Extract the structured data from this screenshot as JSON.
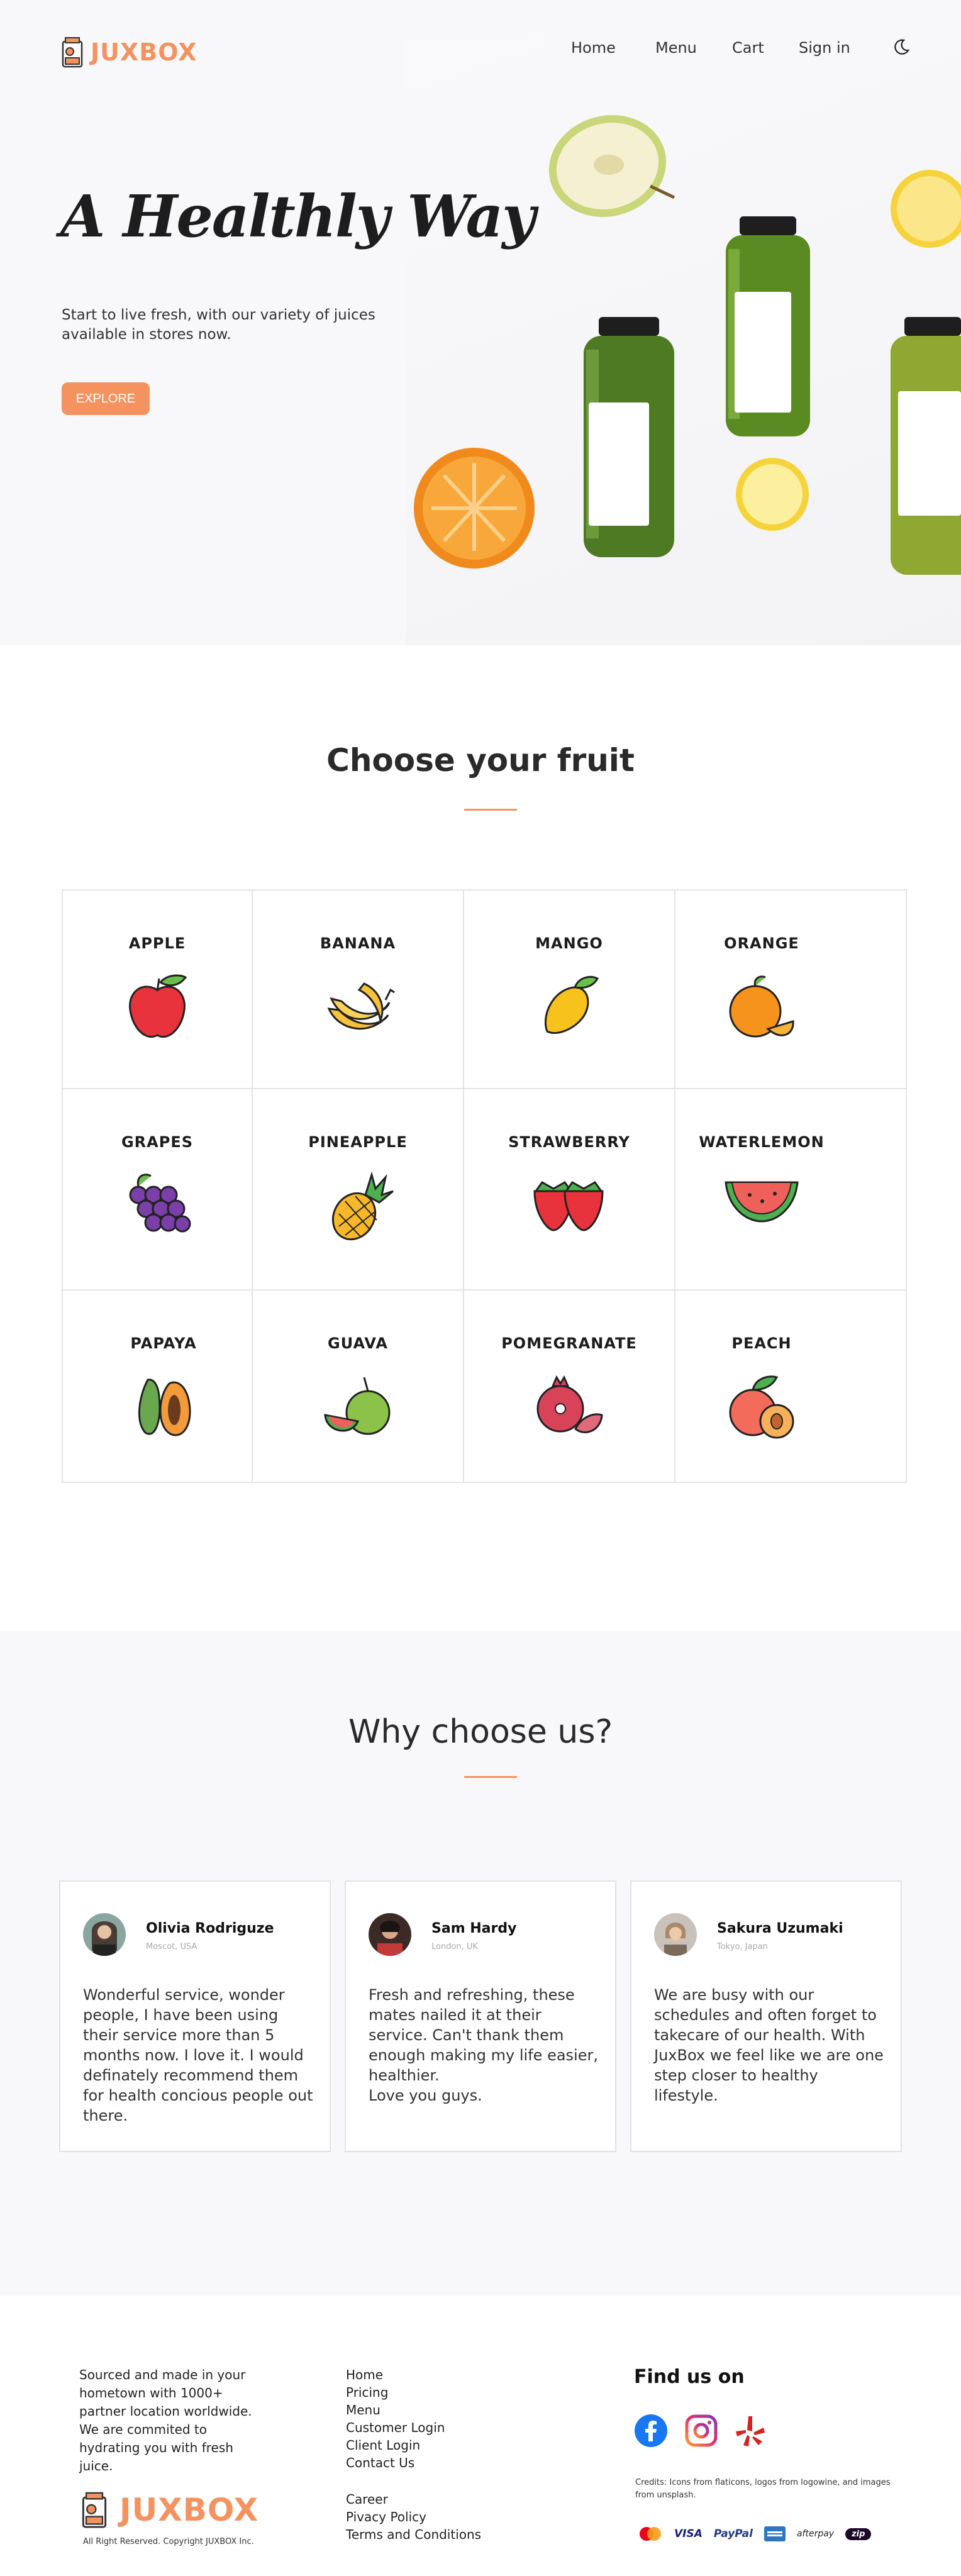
{
  "brand": {
    "name": "JUXBOX",
    "accent": "#f4935f"
  },
  "nav": {
    "home": "Home",
    "menu": "Menu",
    "cart": "Cart",
    "signin": "Sign in"
  },
  "hero": {
    "title": "A Healthly Way",
    "subtitle": "Start to live fresh, with our variety of juices available in stores now.",
    "button": "EXPLORE"
  },
  "fruits": {
    "title": "Choose your fruit",
    "items": [
      {
        "name": "APPLE",
        "icon": "apple-icon"
      },
      {
        "name": "BANANA",
        "icon": "banana-icon"
      },
      {
        "name": "MANGO",
        "icon": "mango-icon"
      },
      {
        "name": "ORANGE",
        "icon": "orange-icon"
      },
      {
        "name": "GRAPES",
        "icon": "grapes-icon"
      },
      {
        "name": "PINEAPPLE",
        "icon": "pineapple-icon"
      },
      {
        "name": "STRAWBERRY",
        "icon": "strawberry-icon"
      },
      {
        "name": "WATERLEMON",
        "icon": "watermelon-icon"
      },
      {
        "name": "PAPAYA",
        "icon": "papaya-icon"
      },
      {
        "name": "GUAVA",
        "icon": "guava-icon"
      },
      {
        "name": "POMEGRANATE",
        "icon": "pomegranate-icon"
      },
      {
        "name": "PEACH",
        "icon": "peach-icon"
      }
    ]
  },
  "why": {
    "title": "Why choose us?",
    "reviews": [
      {
        "name": "Olivia Rodriguze",
        "location": "Moscot, USA",
        "text": "Wonderful service, wonder people, I have been using their service more than 5 months now. I love it. I would definately recommend them for health concious people out there."
      },
      {
        "name": "Sam Hardy",
        "location": "London, UK",
        "text": "Fresh and refreshing, these mates nailed it at their service. Can't thank them enough making my life easier, healthier.\nLove you guys."
      },
      {
        "name": "Sakura Uzumaki",
        "location": "Tokyo, Japan",
        "text": "We are busy with our schedules and often forget to takecare of our health. With JuxBox we feel like we are one step closer to healthy lifestyle."
      }
    ]
  },
  "footer": {
    "about": "Sourced and made in your hometown with 1000+ partner location worldwide. We are commited to hydrating you with fresh juice.",
    "copyright": "All Right Reserved. Copyright JUXBOX Inc.",
    "links1": [
      "Home",
      "Pricing",
      "Menu",
      "Customer Login",
      "Client Login",
      "Contact Us"
    ],
    "links2": [
      "Career",
      "Pivacy Policy",
      "Terms and Conditions"
    ],
    "find_us": "Find us on",
    "socials": [
      "facebook-icon",
      "instagram-icon",
      "yelp-icon"
    ],
    "credits": "Credits: Icons from flaticons, logos from logowine, and images from unsplash.",
    "payments": [
      "VISA",
      "PayPal",
      "afterpay",
      "zip"
    ]
  }
}
